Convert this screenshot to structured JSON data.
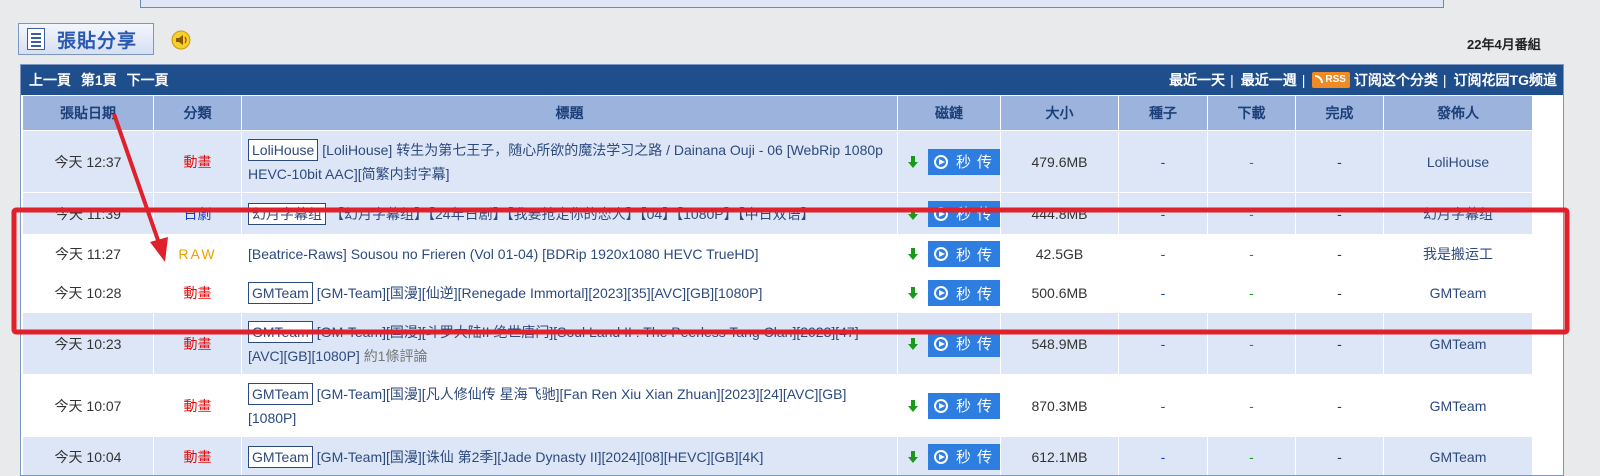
{
  "header": {
    "post_share_label": "張貼分享",
    "season_label": "22年4月番組"
  },
  "navbar": {
    "prev": "上一頁",
    "page": "第1頁",
    "next": "下一頁",
    "last_day": "最近一天",
    "last_week": "最近一週",
    "rss": "RSS",
    "subscribe_category": "订阅这个分类",
    "subscribe_tg": "订阅花园TG频道",
    "separator": "|"
  },
  "columns": {
    "date": "張貼日期",
    "category": "分類",
    "title": "標題",
    "magnet": "磁鏈",
    "size": "大小",
    "seeds": "種子",
    "downloads": "下載",
    "complete": "完成",
    "publisher": "發佈人"
  },
  "magnet_button_label": "秒传",
  "rows": [
    {
      "date": "今天 12:37",
      "category": "動畫",
      "tag": "LoliHouse",
      "title": "[LoliHouse] 转生为第七王子，随心所欲的魔法学习之路 / Dainana Ouji - 06 [WebRip 1080p HEVC-10bit AAC][简繁内封字幕]",
      "comment": "",
      "size": "479.6MB",
      "seeds": "-",
      "downloads": "-",
      "complete": "-",
      "publisher": "LoliHouse"
    },
    {
      "date": "今天 11:39",
      "category": "日劇",
      "tag": "幻月字幕组",
      "title": "【幻月字幕组】【24年日剧】【我要抢走你的恋人】【04】【1080P】【中日双语】",
      "comment": "",
      "size": "444.8MB",
      "seeds": "-",
      "downloads": "-",
      "complete": "-",
      "publisher": "幻月字幕组"
    },
    {
      "date": "今天 11:27",
      "category": "RAW",
      "tag": "",
      "title": "[Beatrice-Raws] Sousou no Frieren (Vol 01-04) [BDRip 1920x1080 HEVC TrueHD]",
      "comment": "",
      "size": "42.5GB",
      "seeds": "-",
      "downloads": "-",
      "complete": "-",
      "publisher": "我是搬运工"
    },
    {
      "date": "今天 10:28",
      "category": "動畫",
      "tag": "GMTeam",
      "title": "[GM-Team][国漫][仙逆][Renegade Immortal][2023][35][AVC][GB][1080P]",
      "comment": "",
      "size": "500.6MB",
      "seeds": "-",
      "downloads": "-",
      "complete": "-",
      "publisher": "GMTeam"
    },
    {
      "date": "今天 10:23",
      "category": "動畫",
      "tag": "GMTeam",
      "title": "[GM-Team][国漫][斗罗大陆II 绝世唐门][Soul Land II : The Peerless Tang Clan][2023][47][AVC][GB][1080P]",
      "comment": "約1條評論",
      "size": "548.9MB",
      "seeds": "-",
      "downloads": "-",
      "complete": "-",
      "publisher": "GMTeam"
    },
    {
      "date": "今天 10:07",
      "category": "動畫",
      "tag": "GMTeam",
      "title": "[GM-Team][国漫][凡人修仙传 星海飞驰][Fan Ren Xiu Xian Zhuan][2023][24][AVC][GB][1080P]",
      "comment": "",
      "size": "870.3MB",
      "seeds": "-",
      "downloads": "-",
      "complete": "-",
      "publisher": "GMTeam"
    },
    {
      "date": "今天 10:04",
      "category": "動畫",
      "tag": "GMTeam",
      "title": "[GM-Team][国漫][诛仙 第2季][Jade Dynasty II][2024][08][HEVC][GB][4K]",
      "comment": "",
      "size": "612.1MB",
      "seeds": "-",
      "downloads": "-",
      "complete": "-",
      "publisher": "GMTeam"
    }
  ],
  "colors": {
    "navbar": "#1f4e8c",
    "header_row": "#9cb4dd",
    "row_alt": "#dce6f7",
    "highlight": "#e0202a",
    "magnet_button": "#2e7de0"
  }
}
